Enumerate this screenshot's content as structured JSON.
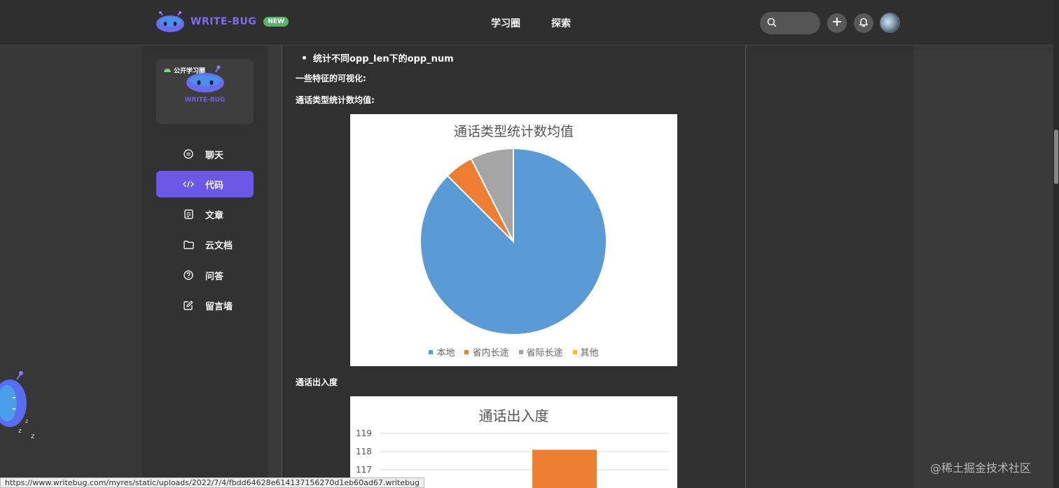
{
  "header": {
    "logo_text": "WRITE-BUG",
    "new_badge": "NEW",
    "nav": [
      "学习圈",
      "探索"
    ]
  },
  "sidebar": {
    "group_tag": "公开学习圈",
    "card_brand": "WRITE-BUG",
    "items": [
      {
        "label": "聊天",
        "icon": "chat-icon"
      },
      {
        "label": "代码",
        "icon": "code-icon",
        "active": true
      },
      {
        "label": "文章",
        "icon": "article-icon"
      },
      {
        "label": "云文档",
        "icon": "folder-icon"
      },
      {
        "label": "问答",
        "icon": "question-icon"
      },
      {
        "label": "留言墙",
        "icon": "edit-icon"
      }
    ]
  },
  "content": {
    "bullet": "统计不同opp_len下的opp_num",
    "viz_heading": "一些特征的可视化:",
    "section1_heading": "通话类型统计数均值:",
    "section2_heading": "通话出入度"
  },
  "chart_data": [
    {
      "type": "pie",
      "title": "通话类型统计数均值",
      "categories": [
        "本地",
        "省内长途",
        "省际长途",
        "其他"
      ],
      "values": [
        87.5,
        5.0,
        7.5,
        0.0
      ],
      "colors": [
        "#5b9bd5",
        "#ed7d31",
        "#a5a5a5",
        "#ffc000"
      ],
      "legend": "bottom"
    },
    {
      "type": "bar",
      "title": "通话出入度",
      "yticks": [
        "119",
        "118",
        "117"
      ],
      "ylim": [
        116,
        119
      ],
      "values": [
        118.1
      ],
      "colors": [
        "#ed7d31"
      ],
      "grid": true
    }
  ],
  "status_bar": {
    "url": "https://www.writebug.com/myres/static/uploads/2022/7/4/fbdd64628e614137156270d1eb60ad67.writebug"
  },
  "watermark": "@稀土掘金技术社区"
}
